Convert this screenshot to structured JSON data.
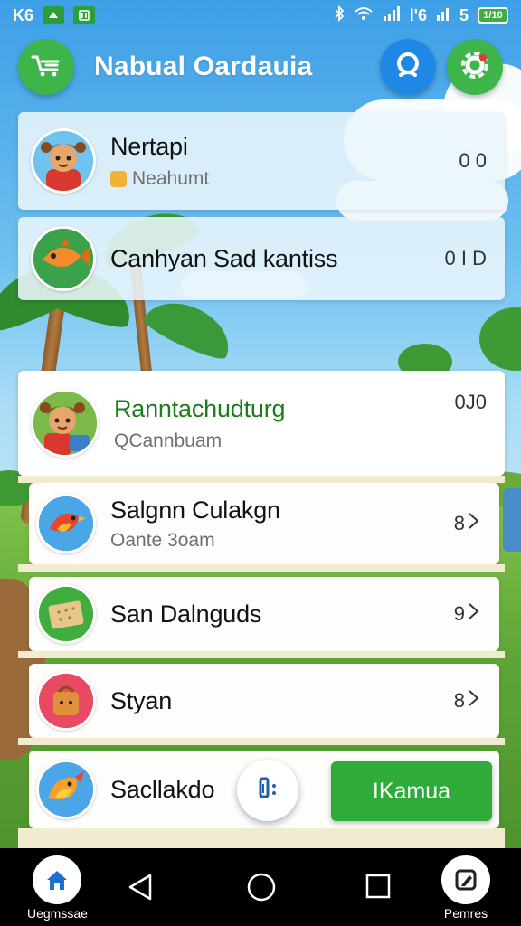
{
  "status_bar": {
    "left_text": "K6",
    "battery_text": "5",
    "battery_inner": "1/10",
    "signal_text": "l'6"
  },
  "header": {
    "title": "Nabual Oardauia",
    "menu_icon": "cart-menu-icon",
    "search_icon": "search-icon",
    "more_icon": "gear-icon"
  },
  "chats": [
    {
      "name": "Nertapi",
      "subtitle": "Neahumt",
      "meta": "0 0",
      "avatar": "girl-avatar",
      "style": "translucent"
    },
    {
      "name": "Canhyan Sad kantiss",
      "subtitle": "",
      "meta": "0 I D",
      "avatar": "fish-avatar",
      "style": "translucent"
    },
    {
      "name": "Ranntachudturg",
      "subtitle": "QCannbuam",
      "meta": "0J0",
      "avatar": "girl-avatar",
      "style": "solid"
    },
    {
      "name": "Salgnn Culakgn",
      "subtitle": "Oante 3oam",
      "meta": "8",
      "avatar": "bird-avatar",
      "style": "sub"
    },
    {
      "name": "San Dalnguds",
      "subtitle": "",
      "meta": "9",
      "avatar": "cracker-avatar",
      "style": "sub"
    },
    {
      "name": "Styan",
      "subtitle": "",
      "meta": "8",
      "avatar": "bag-avatar",
      "style": "sub"
    },
    {
      "name": "Sacllakdo",
      "subtitle": "",
      "meta": "",
      "avatar": "bird-avatar",
      "style": "sub"
    }
  ],
  "floating": {
    "small_button_icon": "chat-bubble-icon",
    "action_label": "IKamua"
  },
  "navbar": {
    "left_label": "Uegmssae",
    "right_label": "Pemres",
    "home_icon": "home-icon",
    "back_icon": "back-icon",
    "home_circle_icon": "circle-home-icon",
    "recents_icon": "square-recents-icon",
    "right_icon": "edit-icon"
  },
  "colors": {
    "accent_green": "#2fab3a",
    "accent_blue": "#1e88e5",
    "name_green": "#1b7d1b"
  }
}
